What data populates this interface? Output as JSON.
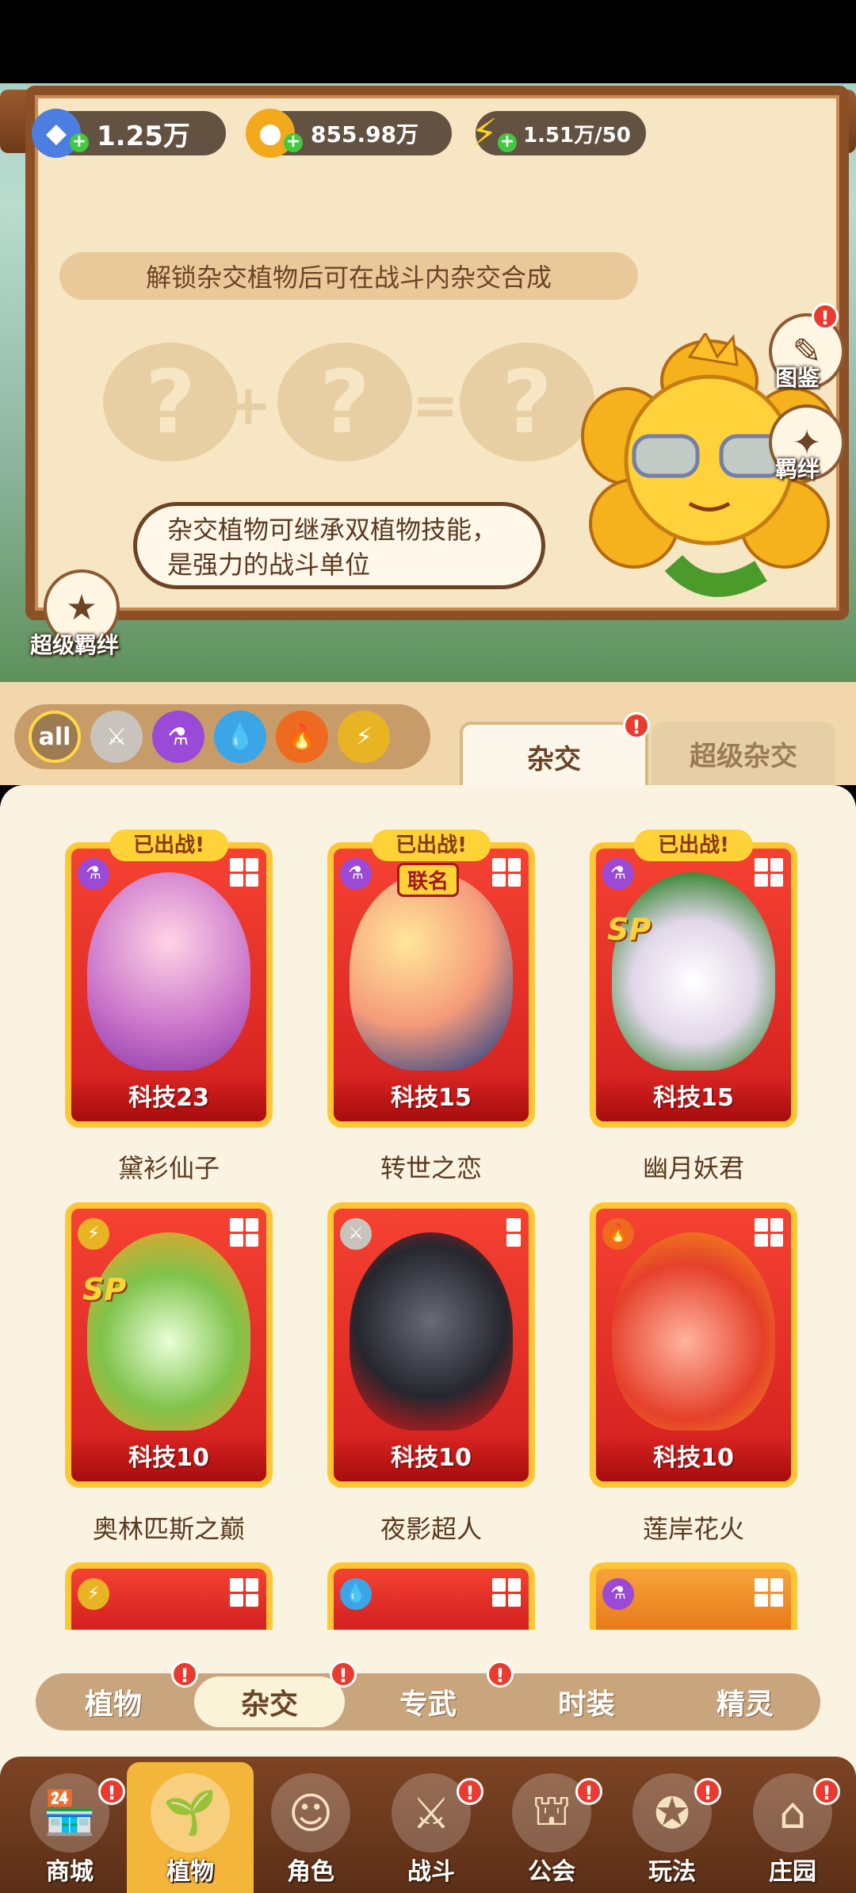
{
  "resources": {
    "gems": "1.25万",
    "coins": "855.98万",
    "energy": "1.51万/50"
  },
  "banner": {
    "title": "解锁杂交植物后可在战斗内杂交合成",
    "bubble": "杂交植物可继承双植物技能，是强力的战斗单位",
    "plus_sign": "+",
    "equals_sign": "=",
    "question_mark": "?"
  },
  "side_buttons": {
    "codex": "图鉴",
    "bond": "羁绊",
    "super_bond": "超级羁绊"
  },
  "filters": {
    "all": "all"
  },
  "panel_tabs": {
    "hybrid": "杂交",
    "super_hybrid": "超级杂交"
  },
  "cards": [
    {
      "name": "黛衫仙子",
      "tech": "科技23",
      "deployed": "已出战!"
    },
    {
      "name": "转世之恋",
      "tech": "科技15",
      "deployed": "已出战!",
      "tag": "联名"
    },
    {
      "name": "幽月妖君",
      "tech": "科技15",
      "deployed": "已出战!",
      "sp": "SP"
    },
    {
      "name": "奥林匹斯之巅",
      "tech": "科技10",
      "sp": "SP"
    },
    {
      "name": "夜影超人",
      "tech": "科技10"
    },
    {
      "name": "莲岸花火",
      "tech": "科技10"
    }
  ],
  "sub_tabs": [
    "植物",
    "杂交",
    "专武",
    "时装",
    "精灵"
  ],
  "bottom_nav": [
    "商城",
    "植物",
    "角色",
    "战斗",
    "公会",
    "玩法",
    "庄园"
  ],
  "badge": "!",
  "colors": {
    "accent_red": "#e93b2f",
    "card_border": "#ffc735",
    "wood": "#8c4f26"
  }
}
